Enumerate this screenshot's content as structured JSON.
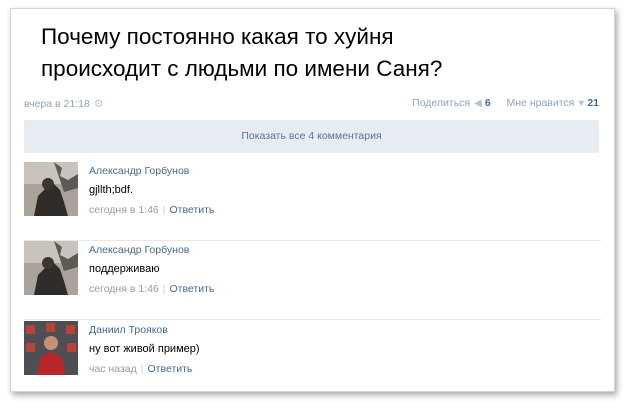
{
  "post": {
    "text_line1": "Почему постоянно какая то хуйня",
    "text_line2": "происходит с людьми по имени Саня?",
    "time": "вчера в 21:18",
    "share_label": "Поделиться",
    "share_count": "6",
    "like_label": "Мне нравится",
    "like_count": "21"
  },
  "show_all_label": "Показать все 4 комментария",
  "comments": [
    {
      "author": "Александр Горбунов",
      "text": "gjllth;bdf.",
      "time": "сегодня в 1:46",
      "reply": "Ответить"
    },
    {
      "author": "Александр Горбунов",
      "text": "поддерживаю",
      "time": "сегодня в 1:46",
      "reply": "Ответить"
    },
    {
      "author": "Даниил Трояков",
      "text": "ну вот живой пример)",
      "time": "час назад",
      "reply": "Ответить"
    }
  ]
}
